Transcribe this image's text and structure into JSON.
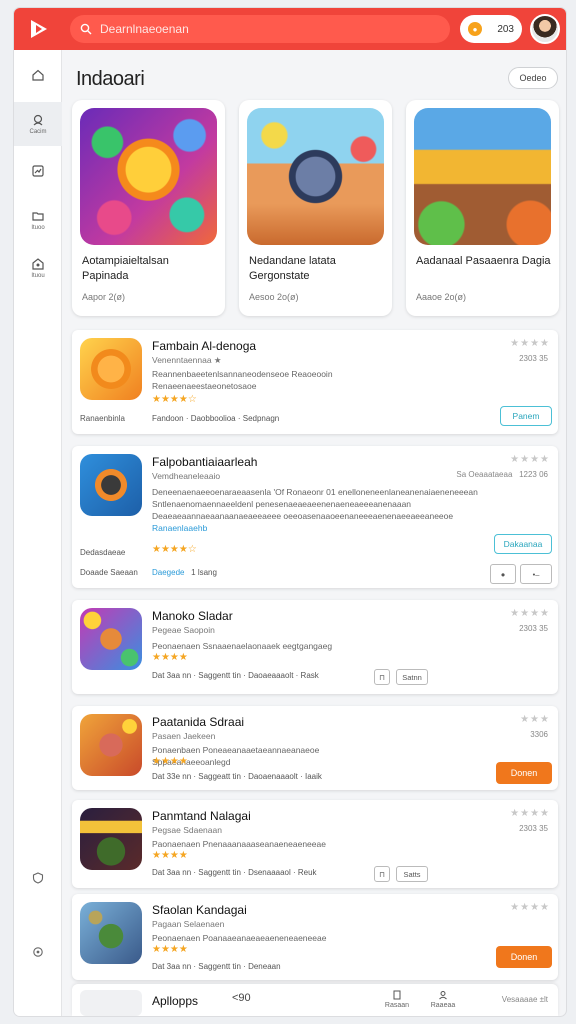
{
  "header": {
    "search_placeholder": "Dearnlnaeoenan",
    "coins": "203"
  },
  "sidebar": {
    "items": [
      {
        "label": ""
      },
      {
        "label": "Cacim"
      },
      {
        "label": ""
      },
      {
        "label": "Ituoo"
      },
      {
        "label": "Ituou"
      }
    ]
  },
  "section": {
    "title": "Indaoari",
    "see_all": "Oedeo"
  },
  "featured": [
    {
      "name": "Aotampiaieltalsan Papinada",
      "meta": "Aapor 2(ø)"
    },
    {
      "name": "Nedandane latata Gergonstate",
      "meta": "Aesoo 2o(ø)"
    },
    {
      "name": "Aadanaal Pasaaenra Dagia",
      "meta": "Aaaoe 2o(ø)"
    }
  ],
  "apps": [
    {
      "name": "Fambain Al-denoga",
      "sub": "Venenntaennaa ★",
      "desc": "Reannenbaeetenlsannaneodenseoe Reaoeooin Renaeenaeestaeonetosaoe",
      "side_label": "Ranaenbinla",
      "meta1": "Fandoon",
      "meta2": "Daobboolioa",
      "meta3": "Sedpnagn",
      "rank": "2303 35",
      "button": "Panem"
    },
    {
      "name": "Falpobantiaiaarleah",
      "sub": "Vemdheaneleaaio",
      "desc": "Deneenaenaeeoenaraeaasenla 'Of Ronaeonr 01 enelloneneenlaneanenaiaeneneeean Sntlenaenomaennaeeldenl penesenaeaeaeenenaeneaeeeanenaaan Deaeaeaannaeaanaanaeaeeaeee oeeoasenaaoeenaneeeaenenaeeaeeaneeoe",
      "desc_link": "Ranaenlaaehb",
      "side_label": "Dedasdaeae",
      "rank_left": "Sa Oeaaataeaa",
      "rank": "1223 06",
      "developer": "Doaade Saeaan",
      "category": "Daegede",
      "size": "1 lsang",
      "button": "Dakaanaa"
    },
    {
      "name": "Manoko Sladar",
      "sub": "Pegeae Saopoin",
      "desc": "Peonaenaen Ssnaaenaelaonaaek eegtgangaeg",
      "rank": "2303 35",
      "meta1": "Dat 3aa nn",
      "meta2": "Saggentt tin",
      "meta3": "Daoaeaaaolt",
      "meta4": "Rask",
      "button": "Satnn"
    },
    {
      "name": "Paatanida Sdraai",
      "sub": "Pasaen Jaekeen",
      "desc": "Ponaenbaen Poneaeanaaetaeannaeanaeoe Sppaeanaeeoanlegd",
      "rank": "3306",
      "meta1": "Dat 33e nn",
      "meta2": "Saggeatt tin",
      "meta3": "Daoaenaaaolt",
      "meta4": "Iaaik",
      "button": "Donen"
    },
    {
      "name": "Panmtand Nalagai",
      "sub": "Pegsae Sdaenaan",
      "desc": "Paonaenaen Pnenaaanaaaseanaeneaeneeae",
      "rank": "2303 35",
      "meta1": "Dat 3aa nn",
      "meta2": "Saggentt tin",
      "meta3": "Dsenaaaaol",
      "meta4": "Reuk",
      "button": "Satts"
    },
    {
      "name": "Sfaolan Kandagai",
      "sub": "Pagaan Selaenaen",
      "desc": "Peonaenaen Poanaaeanaeaeaeneneaeneeae",
      "rank": "",
      "meta1": "Dat 3aa nn",
      "meta2": "Saggentt tin",
      "meta3": "Deneaan",
      "button": "Donen"
    }
  ],
  "bottom": {
    "title": "Apllopps",
    "counter": "<90",
    "item1": "Rasaan",
    "item2": "Raaeaa",
    "right": "Vesaaaae ±lt"
  }
}
